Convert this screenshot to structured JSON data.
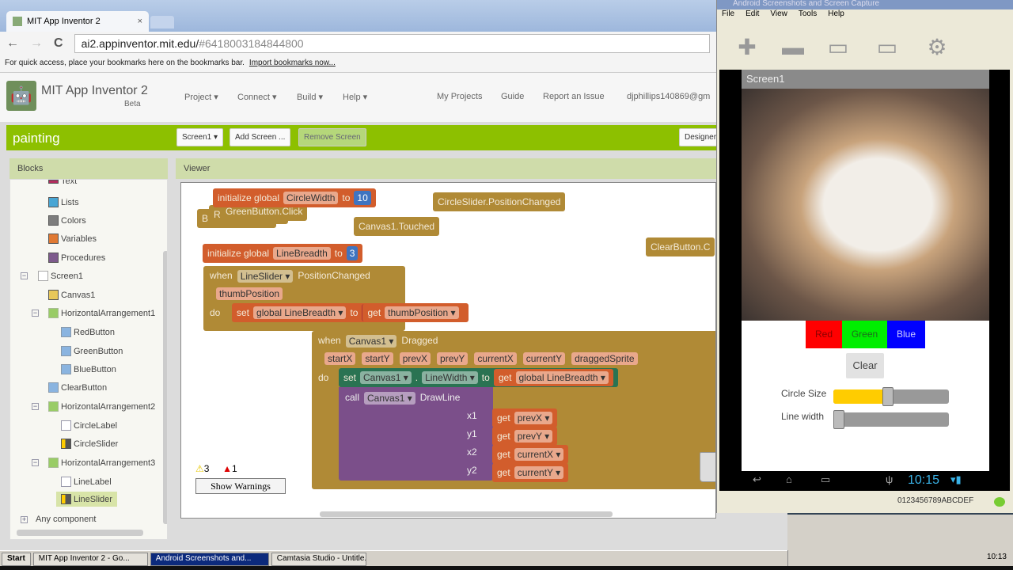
{
  "browser": {
    "tab_title": "MIT App Inventor 2",
    "tab_close": "×",
    "back": "←",
    "forward": "→",
    "reload": "C",
    "url_host": "ai2.appinventor.mit.edu/",
    "url_fragment": "#6418003184844800",
    "bookmarks_text": "For quick access, place your bookmarks here on the bookmarks bar.",
    "bookmarks_link": "Import bookmarks now..."
  },
  "app": {
    "title": "MIT App Inventor 2",
    "beta": "Beta",
    "menus": [
      "Project ▾",
      "Connect ▾",
      "Build ▾",
      "Help ▾"
    ],
    "links": [
      "My Projects",
      "Guide",
      "Report an Issue",
      "djphillips140869@gm"
    ]
  },
  "project": {
    "name": "painting",
    "screen_select": "Screen1 ▾",
    "add_screen": "Add Screen ...",
    "remove_screen": "Remove Screen",
    "designer": "Designer"
  },
  "panels": {
    "blocks": "Blocks",
    "viewer": "Viewer"
  },
  "tree": {
    "builtins": [
      {
        "label": "Text",
        "color": "#b32d5e"
      },
      {
        "label": "Lists",
        "color": "#49a6d4"
      },
      {
        "label": "Colors",
        "color": "#7d7d7d"
      },
      {
        "label": "Variables",
        "color": "#e07933"
      },
      {
        "label": "Procedures",
        "color": "#7d5a8c"
      }
    ],
    "screen": "Screen1",
    "components": [
      "Canvas1",
      "HorizontalArrangement1",
      "RedButton",
      "GreenButton",
      "BlueButton",
      "ClearButton",
      "HorizontalArrangement2",
      "CircleLabel",
      "CircleSlider",
      "HorizontalArrangement3",
      "LineLabel",
      "LineSlider"
    ],
    "any": "Any component"
  },
  "blocks": {
    "init1": {
      "kw": "initialize global",
      "name": "CircleWidth",
      "to": "to",
      "value": "10"
    },
    "green_click": "GreenButton.Click",
    "b_stub": "B",
    "r_stub": "R",
    "circle_changed": "CircleSlider.PositionChanged",
    "canvas_touched": "Canvas1.Touched",
    "clear_click": "ClearButton.C",
    "init2": {
      "kw": "initialize global",
      "name": "LineBreadth",
      "to": "to",
      "value": "3"
    },
    "slider_event": {
      "when": "when",
      "comp": "LineSlider ▾",
      "event": "PositionChanged",
      "param": "thumbPosition",
      "do": "do",
      "set": "set",
      "var": "global LineBreadth ▾",
      "to": "to",
      "get": "get",
      "getvar": "thumbPosition ▾"
    },
    "drag_event": {
      "when": "when",
      "comp": "Canvas1 ▾",
      "event": "Dragged",
      "params": [
        "startX",
        "startY",
        "prevX",
        "prevY",
        "currentX",
        "currentY",
        "draggedSprite"
      ],
      "do": "do",
      "set": "set",
      "set_comp": "Canvas1 ▾",
      "dot": ".",
      "set_prop": "LineWidth ▾",
      "to": "to",
      "get": "get",
      "get_var": "global LineBreadth ▾",
      "call": "call",
      "call_comp": "Canvas1 ▾",
      "method": "DrawLine",
      "args": [
        {
          "name": "x1",
          "var": "prevX ▾"
        },
        {
          "name": "y1",
          "var": "prevY ▾"
        },
        {
          "name": "x2",
          "var": "currentX ▾"
        },
        {
          "name": "y2",
          "var": "currentY ▾"
        }
      ]
    }
  },
  "warnings": {
    "warn_count": "3",
    "error_count": "1",
    "button": "Show Warnings"
  },
  "android": {
    "title": "Android Screenshots and Screen Capture",
    "menu": [
      "File",
      "Edit",
      "View",
      "Tools",
      "Help"
    ],
    "screen_title": "Screen1",
    "buttons": [
      {
        "label": "Red",
        "bg": "#ff0000",
        "fg": "#8b0000"
      },
      {
        "label": "Green",
        "bg": "#00ee00",
        "fg": "#1d6b1d"
      },
      {
        "label": "Blue",
        "bg": "#0000ff",
        "fg": "#ccccff"
      }
    ],
    "clear": "Clear",
    "circle_label": "Circle Size",
    "line_label": "Line width",
    "circle_value_pct": 47,
    "line_value_pct": 0,
    "clock": "10:15",
    "serial": "0123456789ABCDEF"
  },
  "taskbar": {
    "start": "Start",
    "tasks": [
      "MIT App Inventor 2 - Go...",
      "Android Screenshots and...",
      "Camtasia Studio - Untitle..."
    ],
    "time": "10:13"
  }
}
